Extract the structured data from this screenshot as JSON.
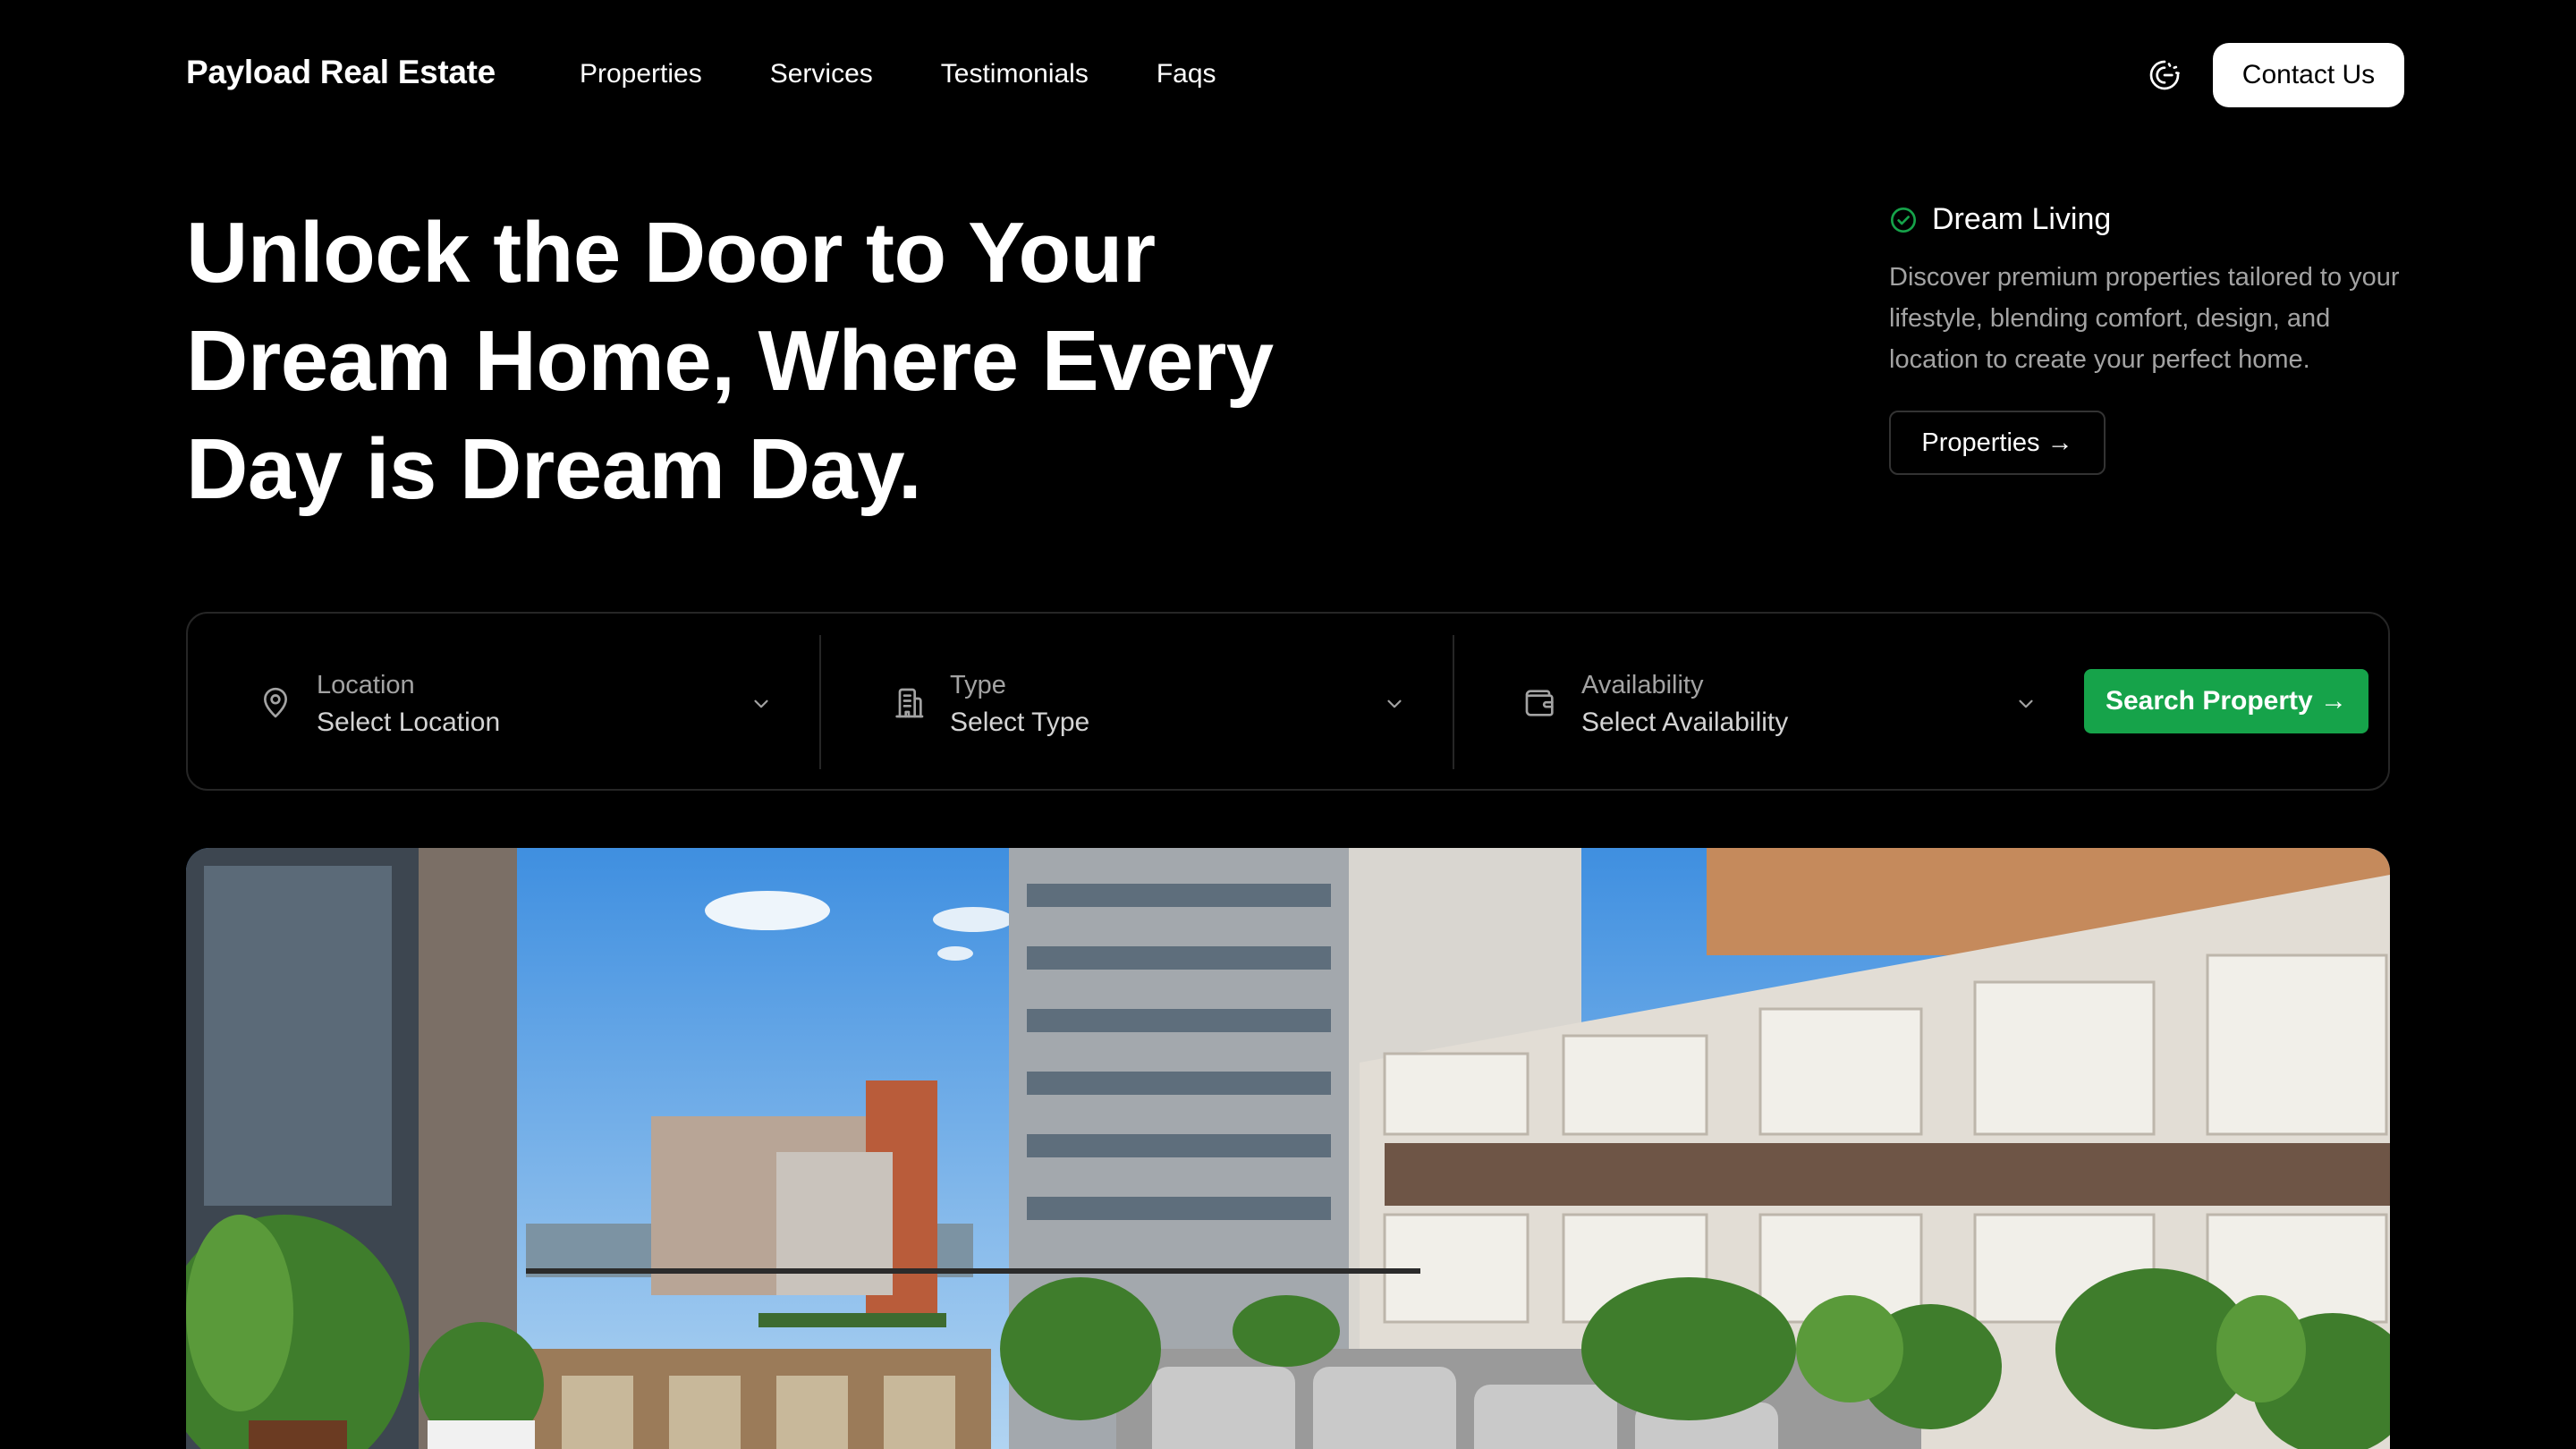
{
  "brand": {
    "name": "Payload Real Estate"
  },
  "nav": {
    "items": [
      "Properties",
      "Services",
      "Testimonials",
      "Faqs"
    ]
  },
  "header": {
    "contact_label": "Contact Us",
    "theme_icon": "moon-sun-icon"
  },
  "hero": {
    "title_lines": [
      "Unlock the Door to Your",
      "Dream Home, Where Every",
      "Day is Dream Day."
    ]
  },
  "dream": {
    "title": "Dream Living",
    "text": "Discover premium properties tailored to your lifestyle, blending comfort, design, and location to create your perfect home.",
    "button_label": "Properties →"
  },
  "search": {
    "fields": [
      {
        "label": "Location",
        "value": "Select Location",
        "icon": "map-pin-icon"
      },
      {
        "label": "Type",
        "value": "Select Type",
        "icon": "building-icon"
      },
      {
        "label": "Availability",
        "value": "Select Availability",
        "icon": "wallet-icon"
      }
    ],
    "button_label": "Search Property →"
  },
  "colors": {
    "accent": "#16a34a",
    "background": "#000000",
    "muted_text": "#a3a3a3"
  }
}
